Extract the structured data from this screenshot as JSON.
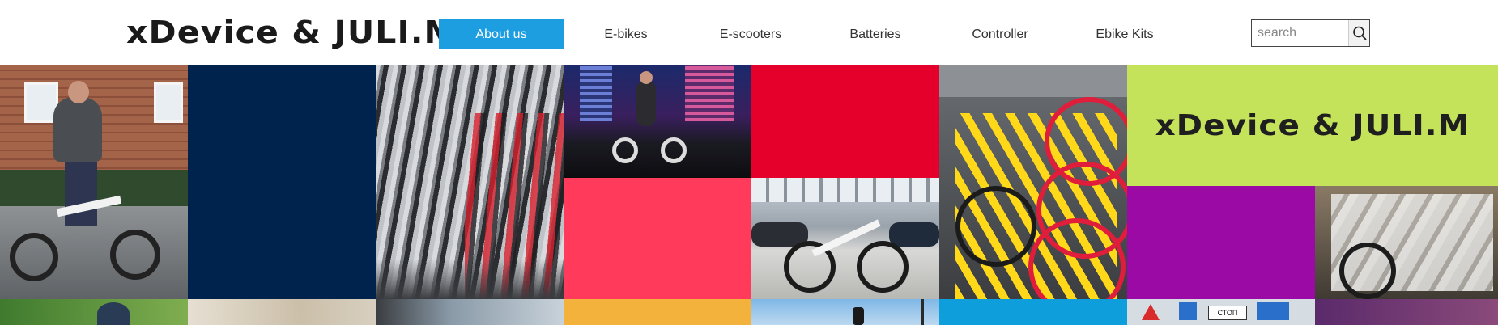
{
  "header": {
    "logo_text": "xDevice & JULI.M",
    "nav": [
      {
        "label": "About us",
        "active": true
      },
      {
        "label": "E-bikes",
        "active": false
      },
      {
        "label": "E-scooters",
        "active": false
      },
      {
        "label": "Batteries",
        "active": false
      },
      {
        "label": "Controller",
        "active": false
      },
      {
        "label": "Ebike Kits",
        "active": false
      }
    ],
    "search": {
      "placeholder": "search",
      "value": "",
      "icon": "search-icon"
    }
  },
  "grid": {
    "brand_tile_logo_text": "xDevice & JULI.M",
    "sign_text": "СТОП",
    "colors": {
      "navy": "#00234d",
      "red": "#e4002b",
      "pink": "#ff3a5a",
      "lime": "#c5e35a",
      "purple": "#9c0aa6",
      "orange": "#f3b23b",
      "blue": "#0d9edb",
      "accent": "#1d9ee0"
    }
  }
}
